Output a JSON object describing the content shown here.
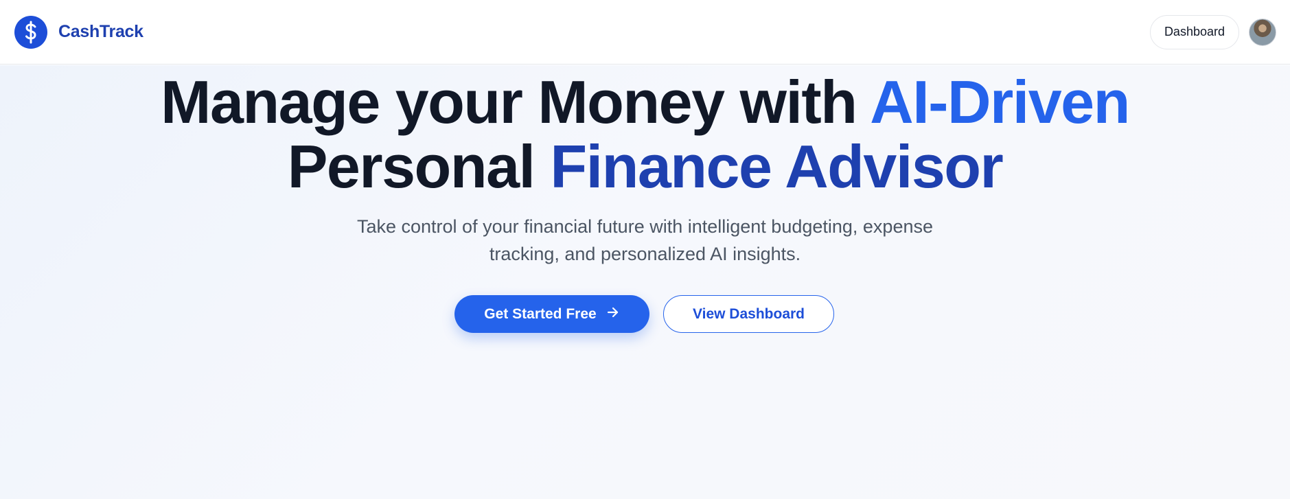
{
  "header": {
    "brand_name": "CashTrack",
    "dashboard_label": "Dashboard",
    "logo_icon": "dollar-sign-icon",
    "avatar": "user-avatar"
  },
  "hero": {
    "headline_part1": "Manage your Money with ",
    "headline_accent1": "AI-Driven",
    "headline_part2": "Personal ",
    "headline_accent2": "Finance Advisor",
    "subtitle_line1": "Take control of your financial future with intelligent budgeting, expense",
    "subtitle_line2": "tracking, and personalized AI insights.",
    "cta_primary": "Get Started Free",
    "cta_primary_icon": "arrow-right-icon",
    "cta_secondary": "View Dashboard"
  },
  "colors": {
    "brand": "#1d4ed8",
    "primary": "#2563eb",
    "accent_dark": "#1e40af",
    "text": "#111827",
    "muted": "#4b5563"
  }
}
